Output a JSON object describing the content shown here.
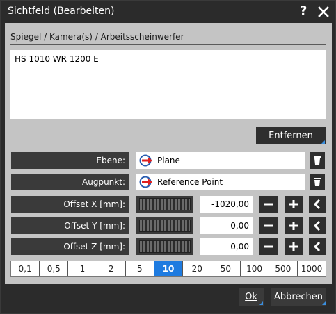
{
  "window": {
    "title": "Sichtfeld (Bearbeiten)",
    "help_label": "?"
  },
  "section": {
    "title": "Spiegel / Kamera(s) / Arbeitsscheinwerfer"
  },
  "list": {
    "text": "HS 1010 WR 1200 E"
  },
  "remove_button": {
    "label": "Entfernen"
  },
  "ebene": {
    "label": "Ebene:",
    "value": "Plane"
  },
  "augpunkt": {
    "label": "Augpunkt:",
    "value": "Reference Point"
  },
  "offsets": [
    {
      "label": "Offset X [mm]:",
      "value": "-1020,00"
    },
    {
      "label": "Offset Y [mm]:",
      "value": "0,00"
    },
    {
      "label": "Offset Z [mm]:",
      "value": "0,00"
    }
  ],
  "steps": {
    "options": [
      "0,1",
      "0,5",
      "1",
      "2",
      "5",
      "10",
      "20",
      "50",
      "100",
      "500",
      "1000"
    ],
    "selected": "10"
  },
  "buttons": {
    "ok": "Ok",
    "cancel": "Abbrechen"
  },
  "colors": {
    "accent": "#1e7be0",
    "link_arrow": "#e02020"
  }
}
